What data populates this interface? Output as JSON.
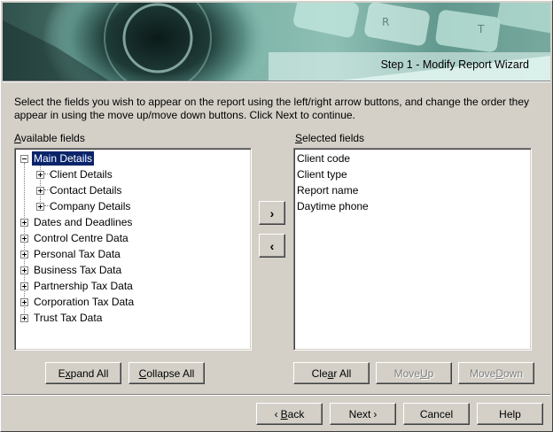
{
  "window": {
    "banner_title": "Step 1 - Modify Report Wizard",
    "instructions": "Select the fields you wish to appear on the report using the left/right arrow buttons, and change the order they appear in using the move up/move down buttons.  Click Next to continue."
  },
  "available": {
    "label_accel": "A",
    "label_rest": "vailable fields",
    "tree": {
      "main": "Main Details",
      "main_children": [
        "Client Details",
        "Contact Details",
        "Company Details"
      ],
      "top_level": [
        "Dates and Deadlines",
        "Control Centre Data",
        "Personal Tax Data",
        "Business Tax Data",
        "Partnership Tax Data",
        "Corporation Tax Data",
        "Trust Tax Data"
      ]
    },
    "expand_pre": "E",
    "expand_accel": "x",
    "expand_post": "pand All",
    "collapse_accel": "C",
    "collapse_post": "ollapse All"
  },
  "selected": {
    "label_accel": "S",
    "label_rest": "elected fields",
    "items": [
      "Client code",
      "Client type",
      "Report name",
      "Daytime phone"
    ],
    "clear_pre": "Cle",
    "clear_accel": "a",
    "clear_post": "r All",
    "moveup_pre": "Move ",
    "moveup_accel": "U",
    "moveup_post": "p",
    "movedown_pre": "Move ",
    "movedown_accel": "D",
    "movedown_post": "own"
  },
  "arrows": {
    "add": "›",
    "remove": "‹"
  },
  "footer": {
    "back_glyph": "‹",
    "back_accel": "B",
    "back_post": "ack",
    "next_label": "Next",
    "next_glyph": "›",
    "cancel_label": "Cancel",
    "help_label": "Help"
  }
}
